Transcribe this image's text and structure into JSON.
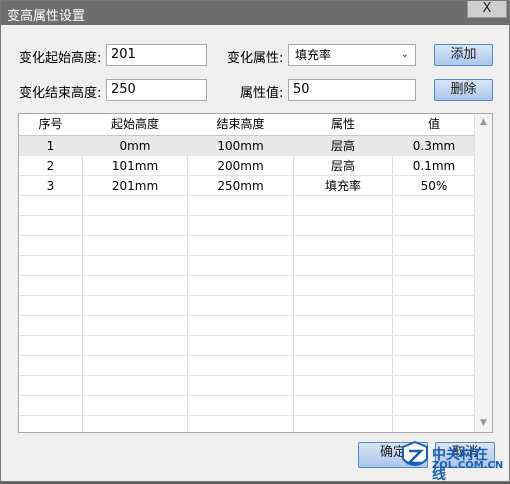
{
  "window": {
    "title": "变高属性设置",
    "close_label": "X"
  },
  "form": {
    "start_height_label": "变化起始高度:",
    "start_height_value": "201",
    "end_height_label": "变化结束高度:",
    "end_height_value": "250",
    "attribute_label": "变化属性:",
    "attribute_selected": "填充率",
    "value_label": "属性值:",
    "value_value": "50",
    "add_label": "添加",
    "delete_label": "删除"
  },
  "table": {
    "columns": [
      "序号",
      "起始高度",
      "结束高度",
      "属性",
      "值"
    ],
    "rows": [
      [
        "1",
        "0mm",
        "100mm",
        "层高",
        "0.3mm"
      ],
      [
        "2",
        "101mm",
        "200mm",
        "层高",
        "0.1mm"
      ],
      [
        "3",
        "201mm",
        "250mm",
        "填充率",
        "50%"
      ]
    ],
    "selected_row": 0
  },
  "footer": {
    "ok_label": "确定",
    "cancel_label": "取消"
  },
  "watermark": {
    "brand": "中关村在线",
    "url": "ZOL.COM.CN"
  }
}
